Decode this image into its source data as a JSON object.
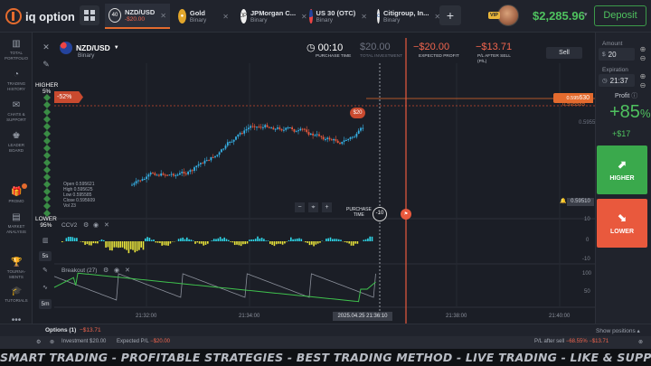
{
  "app": {
    "logo_text": "iq option"
  },
  "tabs": [
    {
      "timer": "40",
      "name": "NZD/USD",
      "sub": "-$20.00",
      "active": true
    },
    {
      "name": "Gold",
      "sub": "Binary"
    },
    {
      "name": "JPMorgan C...",
      "sub": "Binary"
    },
    {
      "name": "US 30 (OTC)",
      "sub": "Binary"
    },
    {
      "name": "Citigroup, In...",
      "sub": "Binary"
    }
  ],
  "header": {
    "vip": "VIP",
    "balance": "$2,285.96",
    "deposit_label": "Deposit"
  },
  "nav": [
    {
      "icon": "chart-icon",
      "label1": "TOTAL",
      "label2": "PORTFOLIO"
    },
    {
      "icon": "history-icon",
      "label1": "TRADING",
      "label2": "HISTORY"
    },
    {
      "icon": "chat-icon",
      "label1": "CHATS &",
      "label2": "SUPPORT"
    },
    {
      "icon": "leaderboard-icon",
      "label1": "LEADER",
      "label2": "BOARD"
    },
    {
      "icon": "promo-icon",
      "label1": "PROMO",
      "label2": ""
    },
    {
      "icon": "market-icon",
      "label1": "MARKET",
      "label2": "ANALYSIS"
    },
    {
      "icon": "tournament-icon",
      "label1": "TOURNA-",
      "label2": "MENTS"
    },
    {
      "icon": "tutorials-icon",
      "label1": "TUTORIALS",
      "label2": ""
    },
    {
      "icon": "more-icon",
      "label1": "MORE",
      "label2": ""
    }
  ],
  "chart_header": {
    "pair": "NZD/USD",
    "pair_sub": "Binary",
    "purchase_time": "00:10",
    "purchase_time_label": "PURCHASE TIME",
    "total_investment": "$20.00",
    "total_investment_label": "TOTAL INVESTMENT",
    "expected_profit": "−$20.00",
    "expected_profit_label": "EXPECTED PROFIT",
    "pl_after_sell": "−$13.71",
    "pl_after_sell_label1": "P/L AFTER SELL",
    "pl_after_sell_label2": "(P/L)",
    "sell_label": "Sell"
  },
  "right_panel": {
    "amount_label": "Amount",
    "amount_value": "20",
    "amount_unit": "$",
    "expiration_label": "Expiration",
    "expiration_value": "21:37",
    "profit_label": "Profit",
    "profit_pct": "+85",
    "profit_pct_unit": "%",
    "profit_abs": "+$17",
    "higher_label": "HIGHER",
    "lower_label": "LOWER"
  },
  "chart": {
    "higher_label": "HIGHER",
    "higher_pct": "5%",
    "lower_label": "LOWER",
    "lower_pct": "95%",
    "neg_badge": "-52%",
    "price_current": "0.595630",
    "price_current_main": "0.595",
    "price_current_tail": "630",
    "price_strike": "0.595585",
    "price_tick": "0.5955",
    "price_low": "0.59510",
    "trade_badge": "$20",
    "purchase_time_label1": "PURCHASE",
    "purchase_time_label2": "TIME",
    "timer": "-10",
    "ohlc": {
      "open": "Open  0.595621",
      "high": "High  0.595625",
      "low": "Low   0.595585",
      "close": "Close 0.595609",
      "vol": "Vol   23"
    },
    "indicator1": "CCV2",
    "indicator2": "Breakout (27)",
    "tf": [
      "5s",
      "5m"
    ],
    "axis_ccv": [
      "10",
      "0",
      "-10"
    ],
    "axis_breakout": [
      "100",
      "50"
    ],
    "times": [
      "21:32:00",
      "21:34:00",
      "21:38:00",
      "21:40:00"
    ],
    "time_current": "2025.04.25 21:36:10"
  },
  "options_bar": {
    "label": "Options (1)",
    "value": "−$13.71",
    "show_positions": "Show positions"
  },
  "position_bar": {
    "investment": "Investment $20.00",
    "expected": "Expected P/L",
    "expected_value": "−$20.00",
    "pl_after_sell": "P/L after sell",
    "pl_pct": "−68.55%",
    "pl_value": "−$13.71"
  },
  "banner": "SMART TRADING - PROFITABLE STRATEGIES - BEST TRADING METHOD - LIVE TRADING - LIKE & SUPPORT FOR MORE FREE STRATEGIES",
  "colors": {
    "accent": "#e46b2e",
    "up": "#4fc25f",
    "down": "#e9593d",
    "candle_up": "#36b1e6",
    "candle_down": "#e9593d"
  }
}
